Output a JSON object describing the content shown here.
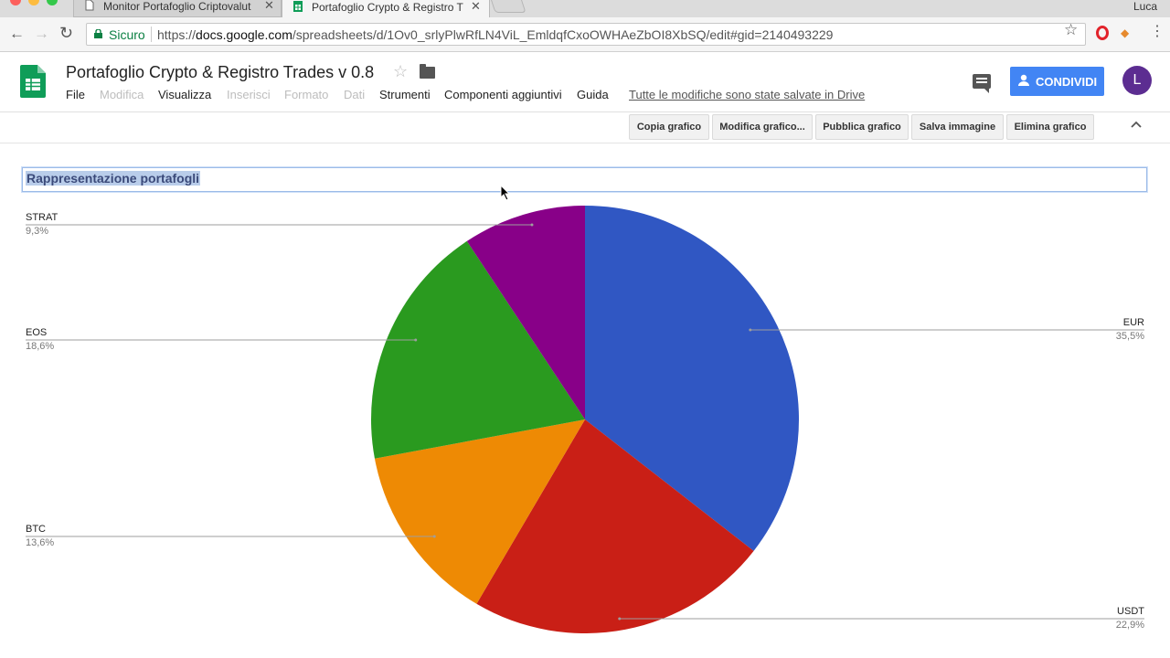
{
  "browser": {
    "tabs": [
      {
        "title": "Monitor Portafoglio Criptovalut",
        "active": false
      },
      {
        "title": "Portafoglio Crypto & Registro T",
        "active": true
      }
    ],
    "profile_name": "Luca",
    "secure_label": "Sicuro",
    "url_scheme": "https://",
    "url_host": "docs.google.com",
    "url_path": "/spreadsheets/d/1Ov0_srlyPlwRfLN4ViL_EmldqfCxoOWHAeZbOI8XbSQ/edit#gid=2140493229"
  },
  "doc": {
    "title": "Portafoglio Crypto & Registro Trades v 0.8",
    "menu": [
      {
        "label": "File",
        "enabled": true
      },
      {
        "label": "Modifica",
        "enabled": false
      },
      {
        "label": "Visualizza",
        "enabled": true
      },
      {
        "label": "Inserisci",
        "enabled": false
      },
      {
        "label": "Formato",
        "enabled": false
      },
      {
        "label": "Dati",
        "enabled": false
      },
      {
        "label": "Strumenti",
        "enabled": true
      },
      {
        "label": "Componenti aggiuntivi",
        "enabled": true
      },
      {
        "label": "Guida",
        "enabled": true
      }
    ],
    "saved_status": "Tutte le modifiche sono state salvate in Drive",
    "share_label": "CONDIVIDI",
    "avatar_letter": "L"
  },
  "chart_toolbar": {
    "buttons": [
      "Copia grafico",
      "Modifica grafico...",
      "Pubblica grafico",
      "Salva immagine",
      "Elimina grafico"
    ]
  },
  "colors": {
    "accent": "#4285f4",
    "sheets_green": "#0f9d58",
    "avatar": "#5c2d91"
  },
  "chart_data": {
    "type": "pie",
    "title": "Rappresentazione portafogli",
    "slices": [
      {
        "label": "EUR",
        "value": 35.5,
        "display": "35,5%",
        "color": "#3057c3"
      },
      {
        "label": "USDT",
        "value": 22.9,
        "display": "22,9%",
        "color": "#c91f16"
      },
      {
        "label": "BTC",
        "value": 13.6,
        "display": "13,6%",
        "color": "#ee8a04"
      },
      {
        "label": "EOS",
        "value": 18.6,
        "display": "18,6%",
        "color": "#2a9a1f"
      },
      {
        "label": "STRAT",
        "value": 9.3,
        "display": "9,3%",
        "color": "#880088"
      }
    ],
    "start": "12 o'clock",
    "direction": "clockwise",
    "legend": "labeled lines, left and right"
  }
}
